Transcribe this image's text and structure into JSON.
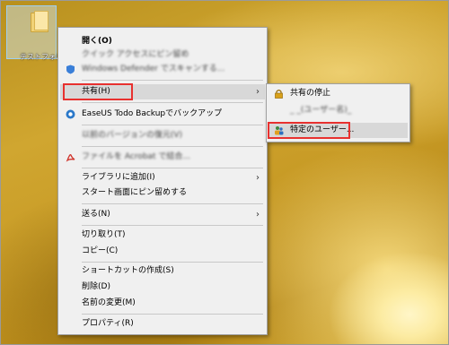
{
  "desktop": {
    "icon_label": "テストフォル..."
  },
  "context_menu": {
    "items": [
      {
        "label": "開く(O)"
      },
      {
        "label": "クイック アクセスにピン留め"
      },
      {
        "label": "Windows Defender でスキャンする..."
      },
      {
        "label": "共有(H)"
      },
      {
        "label": "EaseUS Todo Backupでバックアップ"
      },
      {
        "label": "以前のバージョンの復元(V)"
      },
      {
        "label": "ファイルを Acrobat で結合..."
      },
      {
        "label": "ライブラリに追加(I)"
      },
      {
        "label": "スタート画面にピン留めする"
      },
      {
        "label": "送る(N)"
      },
      {
        "label": "切り取り(T)"
      },
      {
        "label": "コピー(C)"
      },
      {
        "label": "ショートカットの作成(S)"
      },
      {
        "label": "削除(D)"
      },
      {
        "label": "名前の変更(M)"
      },
      {
        "label": "プロパティ(R)"
      }
    ]
  },
  "share_submenu": {
    "items": [
      {
        "label": "共有の停止"
      },
      {
        "label": "_ _(ユーザー名)_"
      },
      {
        "label": "特定のユーザー..."
      }
    ]
  },
  "colors": {
    "highlight_border": "#e8312f",
    "menu_bg": "#f0f0f0"
  }
}
